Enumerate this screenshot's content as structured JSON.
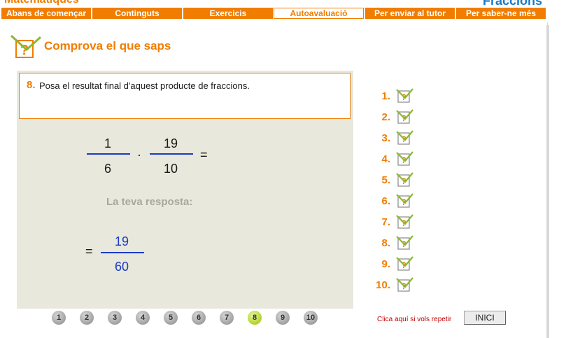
{
  "header": {
    "brand_left": "Matemàtiques",
    "brand_right": "Fraccions"
  },
  "nav": {
    "tabs": [
      {
        "label": "Abans de començar"
      },
      {
        "label": "Continguts"
      },
      {
        "label": "Exercicis"
      },
      {
        "label": "Autoavaluació",
        "active": true
      },
      {
        "label": "Per enviar al tutor"
      },
      {
        "label": "Per saber-ne més"
      }
    ]
  },
  "page": {
    "title": "Comprova el que saps"
  },
  "question": {
    "number": "8.",
    "text": "Posa el resultat final d'aquest producte de fraccions.",
    "fraction1": {
      "numerator": "1",
      "denominator": "6"
    },
    "operator": "·",
    "fraction2": {
      "numerator": "19",
      "denominator": "10"
    },
    "equals": "=",
    "response_label": "La teva resposta:",
    "answer": {
      "equals": "=",
      "numerator": "19",
      "denominator": "60"
    }
  },
  "question_list": [
    "1.",
    "2.",
    "3.",
    "4.",
    "5.",
    "6.",
    "7.",
    "8.",
    "9.",
    "10."
  ],
  "pager": {
    "items": [
      "1",
      "2",
      "3",
      "4",
      "5",
      "6",
      "7",
      "8",
      "9",
      "10"
    ],
    "active": "8"
  },
  "footer": {
    "repeat_text": "Clica aquí si vols repetir",
    "inici_label": "INICI"
  },
  "colors": {
    "accent": "#f07d00",
    "blue": "#1a3cc4",
    "panel": "#e8e8dc",
    "active_circle": "#b8d838"
  }
}
